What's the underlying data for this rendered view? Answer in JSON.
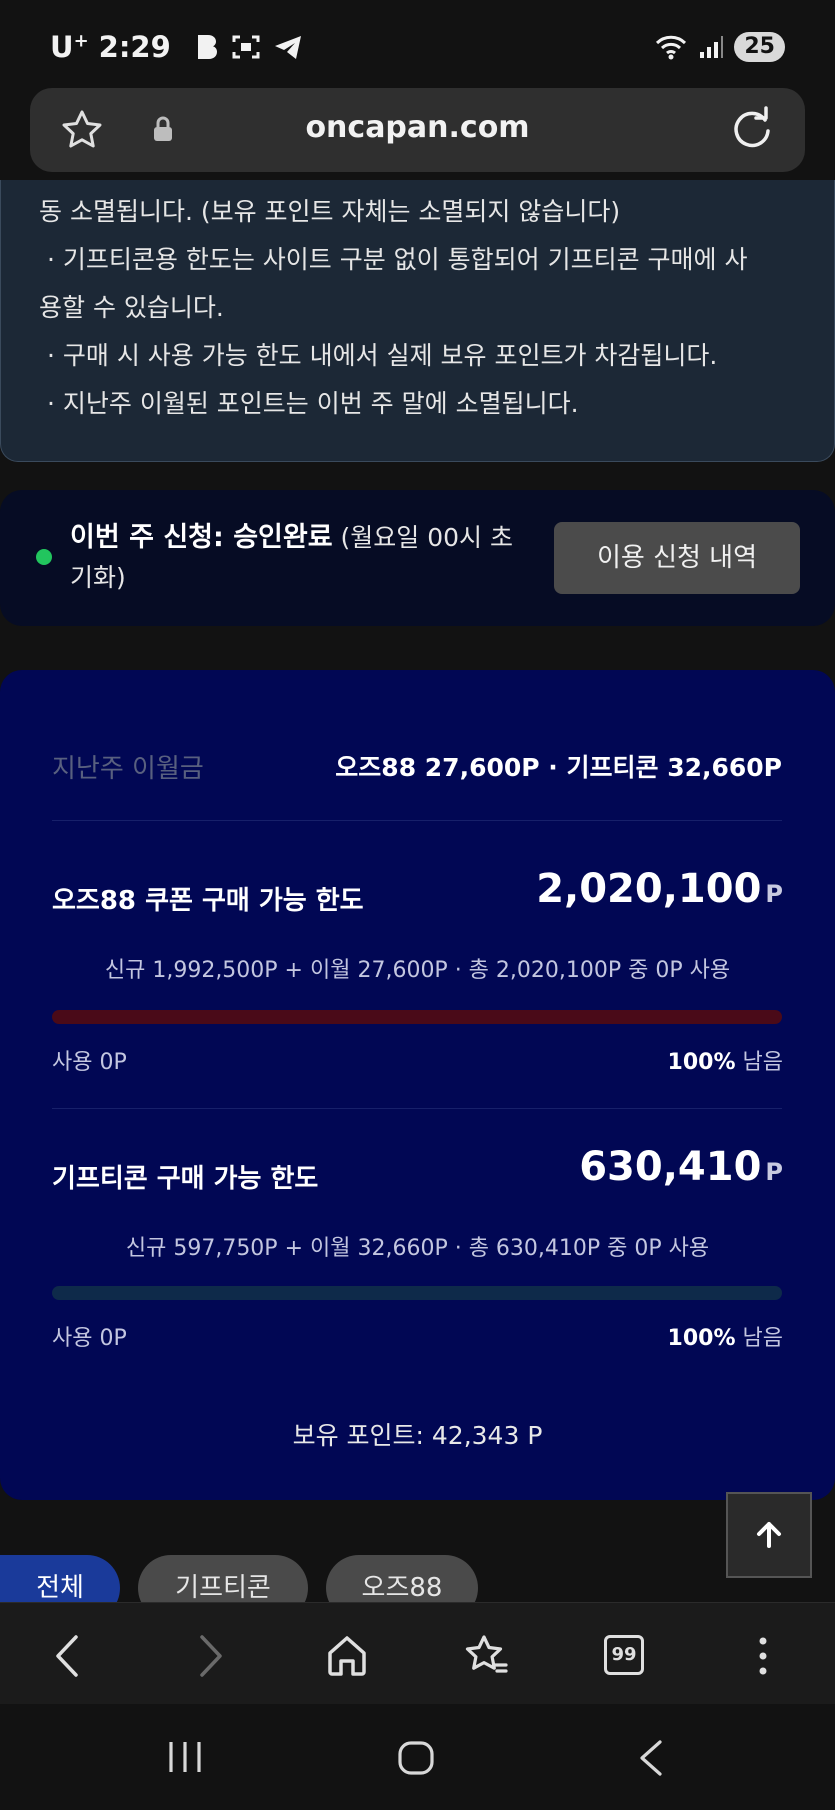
{
  "status_bar": {
    "carrier": "U",
    "carrier_sup": "+",
    "time": "2:29",
    "battery": "25",
    "icons": [
      "b-app-icon",
      "screenshot-icon",
      "telegram-icon",
      "wifi-icon",
      "signal-icon"
    ]
  },
  "browser": {
    "url": "oncapan.com"
  },
  "notice": {
    "lines": [
      "동 소멸됩니다. (보유 포인트 자체는 소멸되지 않습니다)",
      "· 기프티콘용 한도는 사이트 구분 없이 통합되어 기프티콘 구매에 사",
      "용할 수 있습니다.",
      "· 구매 시 사용 가능 한도 내에서 실제 보유 포인트가 차감됩니다.",
      "· 지난주 이월된 포인트는 이번 주 말에 소멸됩니다."
    ]
  },
  "application": {
    "status_bold": "이번 주 신청: 승인완료",
    "status_note": "(월요일 00시 초기화)",
    "history_button": "이용 신청 내역",
    "status_color": "#22c55e"
  },
  "limits": {
    "carryover_label": "지난주 이월금",
    "carryover_value": "오즈88 27,600P · 기프티콘 32,660P",
    "oz88": {
      "title": "오즈88 쿠폰 구매 가능 한도",
      "amount": "2,020,100",
      "unit": "P",
      "detail": "신규 1,992,500P + 이월 27,600P · 총 2,020,100P 중 0P 사용",
      "used": "사용 0P",
      "remaining_pct": "100%",
      "remaining_word": "남음",
      "used_fraction": 0,
      "bar_color": "#4a0a18"
    },
    "gifticon": {
      "title": "기프티콘 구매 가능 한도",
      "amount": "630,410",
      "unit": "P",
      "detail": "신규 597,750P + 이월 32,660P · 총 630,410P 중 0P 사용",
      "used": "사용 0P",
      "remaining_pct": "100%",
      "remaining_word": "남음",
      "used_fraction": 0,
      "bar_color": "#0e2a4a"
    },
    "points": "보유 포인트: 42,343 P"
  },
  "filters": {
    "all": "전체",
    "gifticon": "기프티콘",
    "oz88": "오즈88"
  },
  "bottom_bar": {
    "tabs_count": "99"
  }
}
